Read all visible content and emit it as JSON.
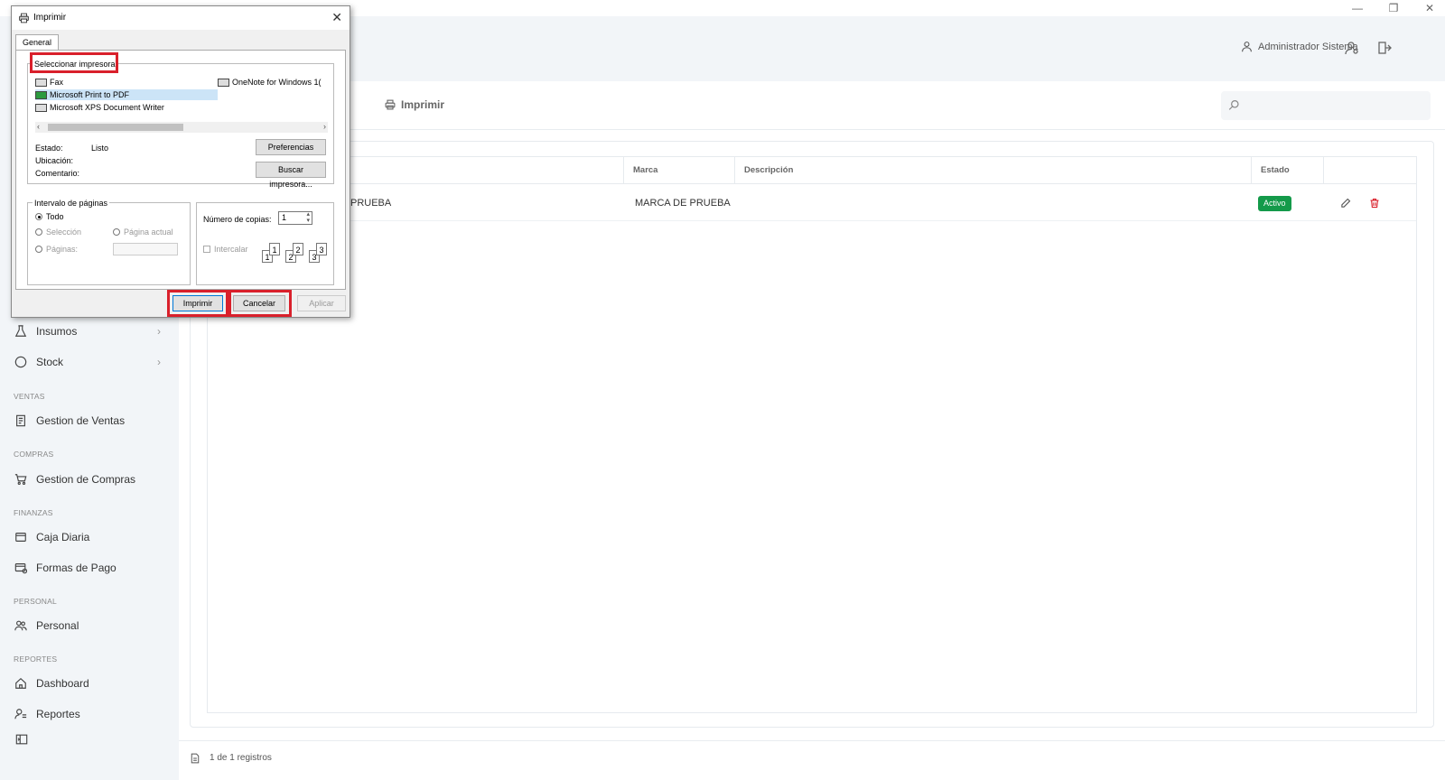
{
  "window": {
    "controls": [
      "—",
      "❐",
      "✕"
    ]
  },
  "header": {
    "user_name": "Administrador Sistema"
  },
  "sidebar": {
    "items": [
      {
        "label": "Insumos"
      },
      {
        "label": "Stock"
      },
      {
        "label": "Gestion de Ventas"
      },
      {
        "label": "Gestion de Compras"
      },
      {
        "label": "Caja Diaria"
      },
      {
        "label": "Formas de Pago"
      },
      {
        "label": "Personal"
      },
      {
        "label": "Dashboard"
      },
      {
        "label": "Reportes"
      }
    ],
    "sections": [
      "VENTAS",
      "COMPRAS",
      "FINANZAS",
      "PERSONAL",
      "REPORTES"
    ]
  },
  "toolbar": {
    "print_label": "Imprimir"
  },
  "table": {
    "columns": [
      "Marca",
      "Descripción",
      "Estado"
    ],
    "rows": [
      {
        "name_fragment": "PRUEBA",
        "marca": "MARCA DE PRUEBA",
        "descripcion": "",
        "estado": "Activo"
      }
    ]
  },
  "footer": {
    "records": "1 de 1 registros"
  },
  "colors": {
    "active_badge": "#149a4a",
    "highlight": "#d9202b",
    "delete_icon": "#d9202b"
  },
  "dialog": {
    "title": "Imprimir",
    "close": "✕",
    "tab": "General",
    "select_printer_label": "Seleccionar impresora",
    "printers": [
      "Fax",
      "Microsoft Print to PDF",
      "Microsoft XPS Document Writer",
      "OneNote for Windows 1("
    ],
    "selected_printer": "Microsoft Print to PDF",
    "status_label": "Estado:",
    "status_value": "Listo",
    "location_label": "Ubicación:",
    "comment_label": "Comentario:",
    "preferences_btn": "Preferencias",
    "find_printer_btn": "Buscar impresora...",
    "page_range_label": "Intervalo de páginas",
    "range_all": "Todo",
    "range_selection": "Selección",
    "range_current": "Página actual",
    "range_pages": "Páginas:",
    "copies_label": "Número de copias:",
    "copies_value": "1",
    "collate_label": "Intercalar",
    "print_btn": "Imprimir",
    "cancel_btn": "Cancelar",
    "apply_btn": "Aplicar"
  }
}
